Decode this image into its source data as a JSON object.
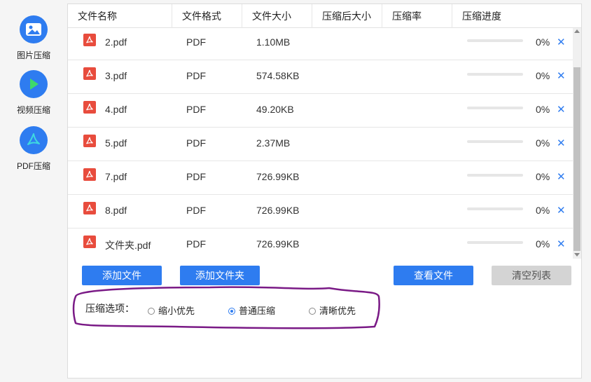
{
  "sidebar": {
    "items": [
      {
        "label": "图片压缩",
        "icon": "image-icon"
      },
      {
        "label": "视频压缩",
        "icon": "play-icon"
      },
      {
        "label": "PDF压缩",
        "icon": "pdf-icon"
      }
    ]
  },
  "table": {
    "headers": [
      "文件名称",
      "文件格式",
      "文件大小",
      "压缩后大小",
      "压缩率",
      "压缩进度"
    ],
    "rows": [
      {
        "name": "2.pdf",
        "format": "PDF",
        "size": "1.10MB",
        "compressed": "",
        "ratio": "",
        "progress": 0,
        "percent": "0%"
      },
      {
        "name": "3.pdf",
        "format": "PDF",
        "size": "574.58KB",
        "compressed": "",
        "ratio": "",
        "progress": 0,
        "percent": "0%"
      },
      {
        "name": "4.pdf",
        "format": "PDF",
        "size": "49.20KB",
        "compressed": "",
        "ratio": "",
        "progress": 0,
        "percent": "0%"
      },
      {
        "name": "5.pdf",
        "format": "PDF",
        "size": "2.37MB",
        "compressed": "",
        "ratio": "",
        "progress": 0,
        "percent": "0%"
      },
      {
        "name": "7.pdf",
        "format": "PDF",
        "size": "726.99KB",
        "compressed": "",
        "ratio": "",
        "progress": 0,
        "percent": "0%"
      },
      {
        "name": "8.pdf",
        "format": "PDF",
        "size": "726.99KB",
        "compressed": "",
        "ratio": "",
        "progress": 0,
        "percent": "0%"
      },
      {
        "name": "文件夹.pdf",
        "format": "PDF",
        "size": "726.99KB",
        "compressed": "",
        "ratio": "",
        "progress": 0,
        "percent": "0%"
      }
    ],
    "remove_symbol": "✕"
  },
  "buttons": {
    "add_file": "添加文件",
    "add_folder": "添加文件夹",
    "view_files": "查看文件",
    "clear_list": "清空列表"
  },
  "options": {
    "label": "压缩选项：",
    "choices": [
      {
        "label": "缩小优先",
        "selected": false
      },
      {
        "label": "普通压缩",
        "selected": true
      },
      {
        "label": "清晰优先",
        "selected": false
      }
    ]
  },
  "colors": {
    "accent": "#2e7cf0",
    "pdf_red": "#e84c3d",
    "annotation": "#7a1a86"
  }
}
